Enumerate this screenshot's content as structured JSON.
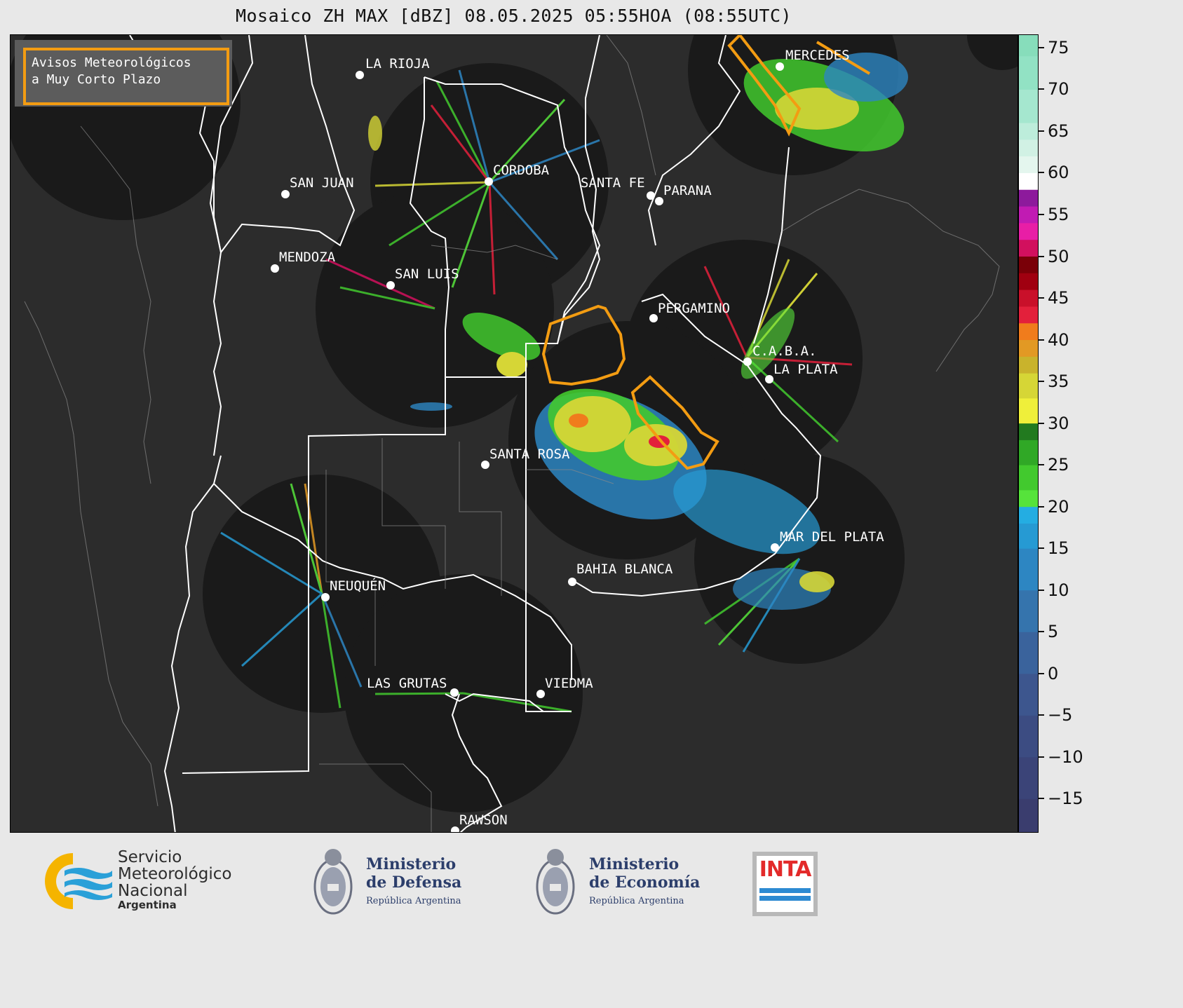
{
  "title": "Mosaico ZH MAX [dBZ] 08.05.2025 05:55HOA (08:55UTC)",
  "avisos": {
    "line1": "Avisos Meteorológicos",
    "line2": "a Muy Corto Plazo"
  },
  "cities": [
    {
      "name": "LA RIOJA",
      "key": "la-rioja"
    },
    {
      "name": "CORDOBA",
      "key": "cordoba"
    },
    {
      "name": "SAN JUAN",
      "key": "san-juan"
    },
    {
      "name": "SANTA FE",
      "key": "santa-fe"
    },
    {
      "name": "PARANA",
      "key": "parana"
    },
    {
      "name": "MENDOZA",
      "key": "mendoza"
    },
    {
      "name": "SAN LUIS",
      "key": "san-luis"
    },
    {
      "name": "PERGAMINO",
      "key": "pergamino"
    },
    {
      "name": "C.A.B.A.",
      "key": "caba"
    },
    {
      "name": "LA PLATA",
      "key": "la-plata"
    },
    {
      "name": "SANTA ROSA",
      "key": "santa-rosa"
    },
    {
      "name": "MAR DEL PLATA",
      "key": "mar-del-plata"
    },
    {
      "name": "BAHIA BLANCA",
      "key": "bahia-blanca"
    },
    {
      "name": "NEUQUÉN",
      "key": "neuquen"
    },
    {
      "name": "LAS GRUTAS",
      "key": "las-grutas"
    },
    {
      "name": "VIEDMA",
      "key": "viedma"
    },
    {
      "name": "RAWSON",
      "key": "rawson"
    },
    {
      "name": "MERCEDES",
      "key": "mercedes"
    }
  ],
  "colorbar": {
    "unit": "dBZ",
    "min": -19,
    "max": 76.5,
    "ticks": [
      "75",
      "70",
      "65",
      "60",
      "55",
      "50",
      "45",
      "40",
      "35",
      "30",
      "25",
      "20",
      "15",
      "10",
      "5",
      "0",
      "−5",
      "−10",
      "−15"
    ],
    "tick_values": [
      75,
      70,
      65,
      60,
      55,
      50,
      45,
      40,
      35,
      30,
      25,
      20,
      15,
      10,
      5,
      0,
      -5,
      -10,
      -15
    ],
    "bands": [
      {
        "from": -19,
        "to": -15,
        "color": "#3a3d6e"
      },
      {
        "from": -15,
        "to": -10,
        "color": "#3b4478"
      },
      {
        "from": -10,
        "to": -5,
        "color": "#3c4c82"
      },
      {
        "from": -5,
        "to": 0,
        "color": "#3d568e"
      },
      {
        "from": 0,
        "to": 5,
        "color": "#3a639c"
      },
      {
        "from": 5,
        "to": 10,
        "color": "#3574ad"
      },
      {
        "from": 10,
        "to": 15,
        "color": "#2d86c2"
      },
      {
        "from": 15,
        "to": 18,
        "color": "#269ad3"
      },
      {
        "from": 18,
        "to": 20,
        "color": "#24ade2"
      },
      {
        "from": 20,
        "to": 22,
        "color": "#56e33b"
      },
      {
        "from": 22,
        "to": 25,
        "color": "#42c92e"
      },
      {
        "from": 25,
        "to": 28,
        "color": "#30a826"
      },
      {
        "from": 28,
        "to": 30,
        "color": "#227a1f"
      },
      {
        "from": 30,
        "to": 33,
        "color": "#efef3a"
      },
      {
        "from": 33,
        "to": 36,
        "color": "#d6d636"
      },
      {
        "from": 36,
        "to": 38,
        "color": "#c9b32c"
      },
      {
        "from": 38,
        "to": 40,
        "color": "#e29924"
      },
      {
        "from": 40,
        "to": 42,
        "color": "#f07c1c"
      },
      {
        "from": 42,
        "to": 44,
        "color": "#e3203b"
      },
      {
        "from": 44,
        "to": 46,
        "color": "#c9102a"
      },
      {
        "from": 46,
        "to": 48,
        "color": "#a00010"
      },
      {
        "from": 48,
        "to": 50,
        "color": "#7a0008"
      },
      {
        "from": 50,
        "to": 52,
        "color": "#d2105e"
      },
      {
        "from": 52,
        "to": 54,
        "color": "#e81ea6"
      },
      {
        "from": 54,
        "to": 56,
        "color": "#c11bb3"
      },
      {
        "from": 56,
        "to": 58,
        "color": "#8d1a9c"
      },
      {
        "from": 58,
        "to": 60,
        "color": "#ffffff"
      },
      {
        "from": 60,
        "to": 62,
        "color": "#e4f6ee"
      },
      {
        "from": 62,
        "to": 64,
        "color": "#d1f1e4"
      },
      {
        "from": 64,
        "to": 66,
        "color": "#bdeddb"
      },
      {
        "from": 66,
        "to": 70,
        "color": "#a5e7cf"
      },
      {
        "from": 70,
        "to": 74,
        "color": "#92e2c4"
      },
      {
        "from": 74,
        "to": 76.5,
        "color": "#87ddbb"
      }
    ]
  },
  "footer": {
    "smn_line1": "Servicio",
    "smn_line2": "Meteorológico",
    "smn_line3": "Nacional",
    "smn_line4": "Argentina",
    "defensa_line1": "Ministerio",
    "defensa_line2": "de Defensa",
    "defensa_line3": "República Argentina",
    "economia_line1": "Ministerio",
    "economia_line2": "de Economía",
    "economia_line3": "República Argentina",
    "inta": "INTA"
  },
  "colors": {
    "map_background": "#2c2c2c",
    "radar_coverage": "#1a1a1a",
    "warning_polygon": "#f39c12",
    "province_border": "#ffffff"
  }
}
